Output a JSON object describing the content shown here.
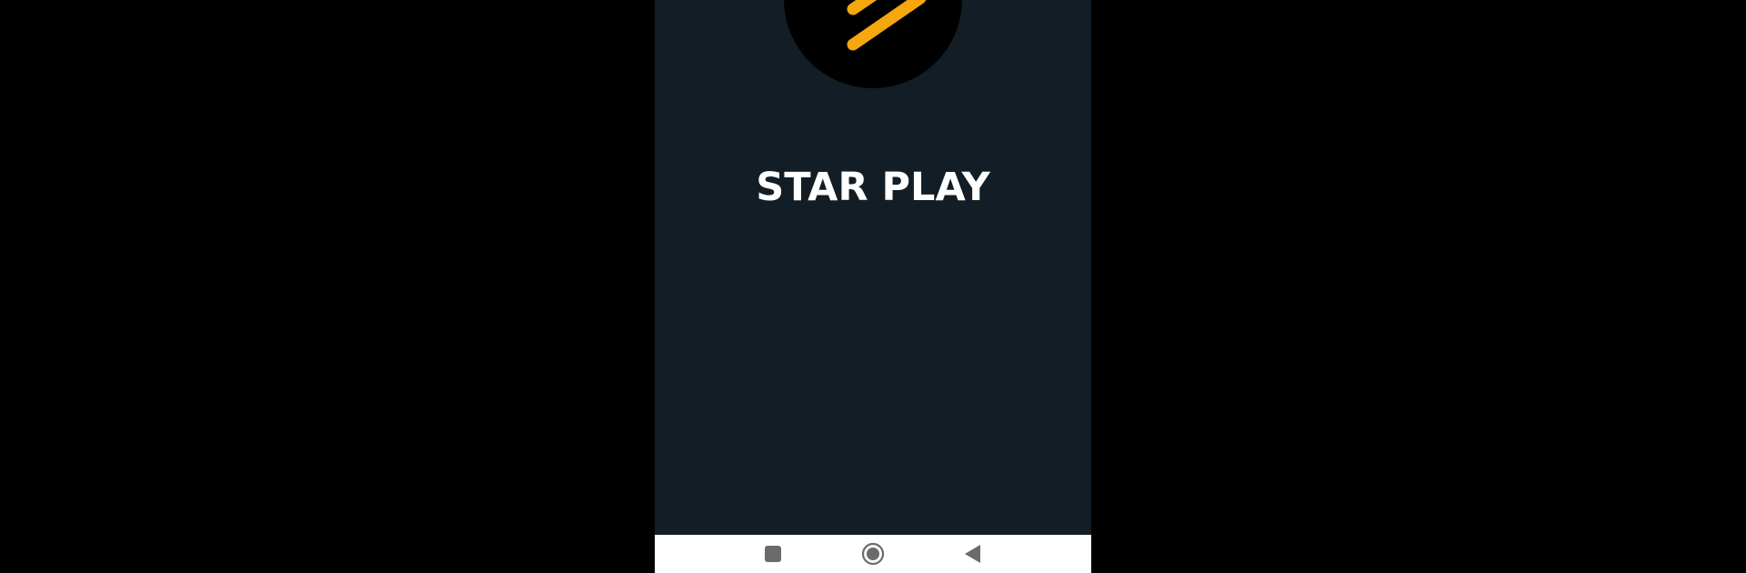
{
  "app": {
    "title": "STAR PLAY",
    "logo_icon": "star-play-logo-icon"
  },
  "colors": {
    "page_background": "#000000",
    "app_background": "#121d25",
    "logo_background": "#000000",
    "logo_stripes": "#f6a70d",
    "title_text": "#ffffff",
    "nav_bar": "#ffffff",
    "nav_icons": "#6b6b6b"
  },
  "nav_bar": {
    "buttons": [
      {
        "icon": "recents-square-icon"
      },
      {
        "icon": "home-circle-icon"
      },
      {
        "icon": "back-triangle-icon"
      }
    ]
  }
}
